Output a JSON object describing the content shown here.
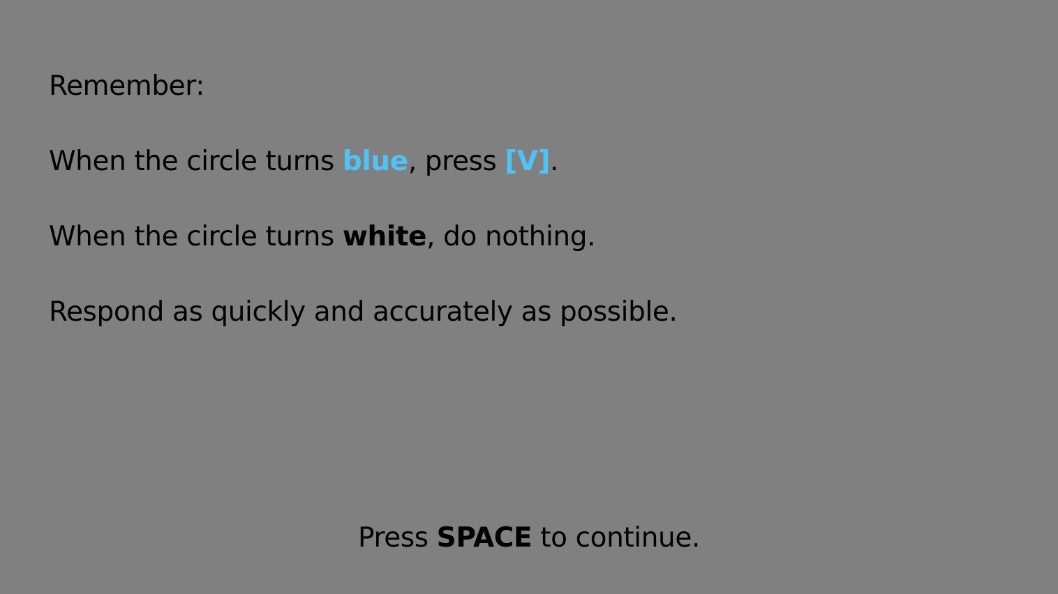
{
  "colors": {
    "background": "#808080",
    "text": "#000000",
    "accent": "#4fc3f7"
  },
  "instructions": {
    "heading": "Remember:",
    "line_blue": {
      "prefix": "When the circle turns ",
      "color_word": "blue",
      "middle": ", press ",
      "key": "[V]",
      "suffix": "."
    },
    "line_white": {
      "prefix": "When the circle turns ",
      "color_word": "white",
      "suffix": ", do nothing."
    },
    "speed_note": "Respond as quickly and accurately as possible."
  },
  "footer": {
    "prefix": "Press ",
    "key": "SPACE",
    "suffix": " to continue."
  }
}
